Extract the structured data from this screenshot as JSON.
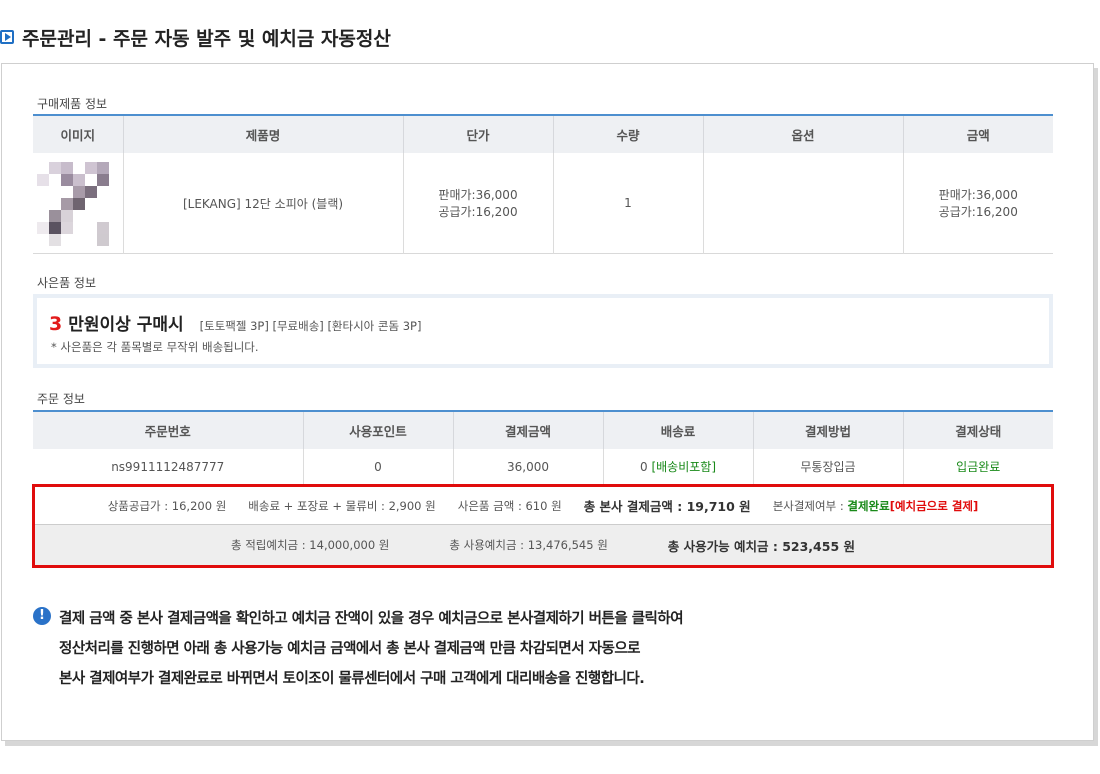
{
  "header": {
    "title": "주문관리 - 주문 자동 발주 및 예치금 자동정산"
  },
  "product_section": {
    "label": "구매제품 정보",
    "columns": [
      "이미지",
      "제품명",
      "단가",
      "수량",
      "옵션",
      "금액"
    ],
    "row": {
      "name": "[LEKANG] 12단 소피아 (블랙)",
      "price_sale": "판매가:36,000",
      "price_supply": "공급가:16,200",
      "qty": "1",
      "option": "",
      "amount_sale": "판매가:36,000",
      "amount_supply": "공급가:16,200"
    }
  },
  "gift_section": {
    "label": "사은품 정보",
    "number": "3",
    "headline": "만원이상 구매시",
    "items": "[토토팩젤 3P] [무료배송] [환타시아 콘돔 3P]",
    "note": "* 사은품은 각 품목별로 무작위 배송됩니다."
  },
  "order_section": {
    "label": "주문 정보",
    "columns": [
      "주문번호",
      "사용포인트",
      "결제금액",
      "배송료",
      "결제방법",
      "결제상태"
    ],
    "row": {
      "order_no": "ns9911112487777",
      "points": "0",
      "amount": "36,000",
      "shipping": "0",
      "shipping_note": "[배송비포함]",
      "method": "무통장입금",
      "status": "입금완료"
    }
  },
  "summary": {
    "supply": "상품공급가 : 16,200 원",
    "shipping": "배송료 + 포장료 + 물류비 : 2,900 원",
    "gift": "사은품 금액 : 610 원",
    "hq_total": "총 본사 결제금액 : 19,710 원",
    "hq_status_label": "본사결제여부 :",
    "hq_status_value": "결제완료",
    "hq_status_note": "[예치금으로 결제]",
    "deposit_total": "총 적립예치금 : 14,000,000 원",
    "deposit_used": "총 사용예치금 : 13,476,545 원",
    "deposit_available": "총 사용가능 예치금 : 523,455 원"
  },
  "notice": {
    "icon": "!",
    "lines": [
      "결제 금액 중 본사 결제금액을 확인하고 예치금 잔액이 있을 경우 예치금으로 본사결제하기 버튼을 클릭하여",
      "정산처리를 진행하면 아래 총 사용가능 예치금 금액에서 총 본사 결제금액 만큼 차감되면서 자동으로",
      "본사 결제여부가 결제완료로 바뀌면서 토이조이 물류센터에서 구매 고객에게 대리배송을 진행합니다."
    ]
  },
  "colors": {
    "accent": "#4d8fcf",
    "alert": "#e00c0c",
    "success": "#1a8a1a",
    "info": "#2a72c8"
  }
}
